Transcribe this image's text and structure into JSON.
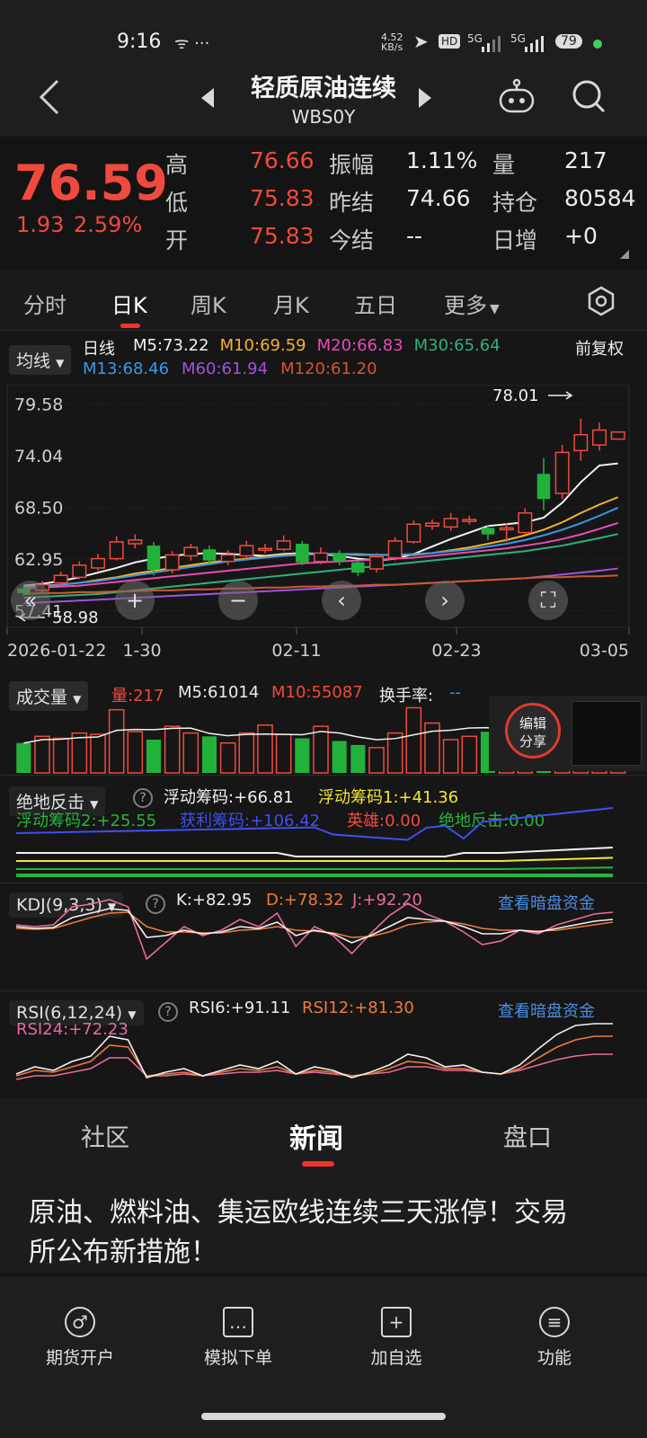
{
  "status": {
    "time": "9:16",
    "net_speed_top": "4.52",
    "net_speed_bottom": "KB/s",
    "hd": "HD",
    "sig1": "5G",
    "sig2": "5G",
    "battery": "79"
  },
  "header": {
    "title": "轻质原油连续",
    "code": "WBS0Y"
  },
  "quote": {
    "price": "76.59",
    "change": "1.93",
    "change_pct": "2.59%",
    "rows": [
      [
        {
          "label": "高",
          "value": "76.66"
        },
        {
          "label": "振幅",
          "value": "1.11%"
        },
        {
          "label": "量",
          "value": "217"
        }
      ],
      [
        {
          "label": "低",
          "value": "75.83"
        },
        {
          "label": "昨结",
          "value": "74.66"
        },
        {
          "label": "持仓",
          "value": "80584"
        }
      ],
      [
        {
          "label": "开",
          "value": "75.83"
        },
        {
          "label": "今结",
          "value": "--"
        },
        {
          "label": "日增",
          "value": "+0"
        }
      ]
    ]
  },
  "tabs": {
    "items": [
      "分时",
      "日K",
      "周K",
      "月K",
      "五日",
      "更多"
    ],
    "active": 1
  },
  "ma": {
    "dropdown": "均线",
    "type": "日线",
    "right_label": "前复权",
    "row1": [
      {
        "text": "M5:73.22",
        "color": "#f2f2f2"
      },
      {
        "text": "M10:69.59",
        "color": "#f6b22a"
      },
      {
        "text": "M20:66.83",
        "color": "#ea4bb2"
      },
      {
        "text": "M30:65.64",
        "color": "#2bb37a"
      }
    ],
    "row2": [
      {
        "text": "M13:68.46",
        "color": "#3a98e8"
      },
      {
        "text": "M60:61.94",
        "color": "#a052e0"
      },
      {
        "text": "M120:61.20",
        "color": "#d0582c"
      }
    ]
  },
  "kline": {
    "y_ticks": [
      "79.58",
      "74.04",
      "68.50",
      "62.95",
      "57.41"
    ],
    "x_ticks": [
      "2026-01-22",
      "1-30",
      "02-11",
      "02-23",
      "03-05"
    ],
    "max_label": "78.01",
    "min_label": "58.98",
    "candles": [
      {
        "o": 59.8,
        "c": 59.3,
        "h": 60.1,
        "l": 59.0
      },
      {
        "o": 59.6,
        "c": 60.2,
        "h": 60.6,
        "l": 59.4
      },
      {
        "o": 60.4,
        "c": 61.2,
        "h": 61.6,
        "l": 60.1
      },
      {
        "o": 61.0,
        "c": 62.3,
        "h": 62.7,
        "l": 60.8
      },
      {
        "o": 62.0,
        "c": 63.0,
        "h": 63.5,
        "l": 61.7
      },
      {
        "o": 63.0,
        "c": 64.8,
        "h": 65.4,
        "l": 62.8
      },
      {
        "o": 64.6,
        "c": 65.0,
        "h": 65.6,
        "l": 64.1
      },
      {
        "o": 64.4,
        "c": 61.8,
        "h": 64.8,
        "l": 61.2
      },
      {
        "o": 61.8,
        "c": 63.4,
        "h": 63.8,
        "l": 61.4
      },
      {
        "o": 63.3,
        "c": 64.2,
        "h": 64.6,
        "l": 62.8
      },
      {
        "o": 64.0,
        "c": 62.8,
        "h": 64.4,
        "l": 62.3
      },
      {
        "o": 62.7,
        "c": 63.4,
        "h": 63.9,
        "l": 62.3
      },
      {
        "o": 63.3,
        "c": 64.4,
        "h": 64.9,
        "l": 63.0
      },
      {
        "o": 64.0,
        "c": 64.1,
        "h": 64.6,
        "l": 63.6
      },
      {
        "o": 64.0,
        "c": 64.9,
        "h": 65.5,
        "l": 63.8
      },
      {
        "o": 64.6,
        "c": 62.6,
        "h": 64.9,
        "l": 62.3
      },
      {
        "o": 62.7,
        "c": 63.6,
        "h": 64.2,
        "l": 62.4
      },
      {
        "o": 63.6,
        "c": 62.7,
        "h": 63.9,
        "l": 62.3
      },
      {
        "o": 62.6,
        "c": 61.5,
        "h": 62.9,
        "l": 61.1
      },
      {
        "o": 61.9,
        "c": 63.2,
        "h": 63.6,
        "l": 61.5
      },
      {
        "o": 63.1,
        "c": 64.9,
        "h": 65.3,
        "l": 62.8
      },
      {
        "o": 64.8,
        "c": 66.7,
        "h": 67.1,
        "l": 64.6
      },
      {
        "o": 66.5,
        "c": 66.8,
        "h": 67.2,
        "l": 66.1
      },
      {
        "o": 66.4,
        "c": 67.3,
        "h": 67.9,
        "l": 66.0
      },
      {
        "o": 67.0,
        "c": 67.2,
        "h": 67.6,
        "l": 66.7
      },
      {
        "o": 66.3,
        "c": 65.6,
        "h": 66.6,
        "l": 65.0
      },
      {
        "o": 66.2,
        "c": 66.3,
        "h": 66.8,
        "l": 64.8
      },
      {
        "o": 65.8,
        "c": 67.9,
        "h": 68.4,
        "l": 65.6
      },
      {
        "o": 72.1,
        "c": 69.4,
        "h": 73.8,
        "l": 68.2
      },
      {
        "o": 70.0,
        "c": 74.4,
        "h": 75.2,
        "l": 69.4
      },
      {
        "o": 74.6,
        "c": 76.3,
        "h": 78.01,
        "l": 73.5
      },
      {
        "o": 75.2,
        "c": 76.8,
        "h": 77.6,
        "l": 74.6
      },
      {
        "o": 75.83,
        "c": 76.59,
        "h": 76.66,
        "l": 75.83
      }
    ],
    "ma_lines": [
      {
        "name": "M5",
        "color": "#f2f2f2",
        "values": [
          60.1,
          60.3,
          60.6,
          61.0,
          61.5,
          62.0,
          62.6,
          63.0,
          63.3,
          63.5,
          63.6,
          63.5,
          63.4,
          63.3,
          63.5,
          63.6,
          63.5,
          63.3,
          63.0,
          62.8,
          63.0,
          63.5,
          64.3,
          65.1,
          65.8,
          66.5,
          66.7,
          66.9,
          67.4,
          69.0,
          71.2,
          73.0,
          73.22
        ]
      },
      {
        "name": "M10",
        "color": "#f6b22a",
        "values": [
          60.0,
          60.1,
          60.2,
          60.4,
          60.7,
          61.0,
          61.4,
          61.7,
          62.0,
          62.3,
          62.6,
          62.8,
          63.0,
          63.2,
          63.4,
          63.5,
          63.5,
          63.5,
          63.4,
          63.4,
          63.4,
          63.4,
          63.6,
          63.9,
          64.2,
          64.6,
          65.0,
          65.5,
          66.1,
          66.9,
          67.9,
          68.8,
          69.59
        ]
      },
      {
        "name": "M20",
        "color": "#ea4bb2",
        "values": [
          59.8,
          59.9,
          60.0,
          60.1,
          60.3,
          60.5,
          60.7,
          60.9,
          61.1,
          61.3,
          61.5,
          61.7,
          61.9,
          62.1,
          62.3,
          62.5,
          62.6,
          62.7,
          62.8,
          62.9,
          63.0,
          63.1,
          63.3,
          63.5,
          63.7,
          63.9,
          64.1,
          64.4,
          64.7,
          65.1,
          65.6,
          66.2,
          66.83
        ]
      },
      {
        "name": "M30",
        "color": "#2bb37a",
        "values": [
          58.8,
          58.9,
          59.0,
          59.1,
          59.2,
          59.4,
          59.6,
          59.8,
          60.0,
          60.2,
          60.4,
          60.6,
          60.8,
          61.0,
          61.2,
          61.4,
          61.6,
          61.8,
          62.0,
          62.2,
          62.4,
          62.6,
          62.8,
          63.0,
          63.2,
          63.4,
          63.6,
          63.8,
          64.1,
          64.4,
          64.8,
          65.2,
          65.64
        ]
      },
      {
        "name": "M13",
        "color": "#3a98e8",
        "values": [
          59.9,
          60.0,
          60.2,
          60.4,
          60.6,
          60.9,
          61.2,
          61.5,
          61.8,
          62.1,
          62.4,
          62.7,
          62.9,
          63.1,
          63.3,
          63.4,
          63.5,
          63.5,
          63.5,
          63.4,
          63.4,
          63.5,
          63.6,
          63.8,
          64.0,
          64.3,
          64.6,
          65.0,
          65.5,
          66.1,
          66.8,
          67.6,
          68.46
        ]
      },
      {
        "name": "M60",
        "color": "#a052e0",
        "values": [
          58.2,
          58.3,
          58.4,
          58.5,
          58.6,
          58.7,
          58.8,
          58.9,
          59.0,
          59.1,
          59.2,
          59.3,
          59.4,
          59.5,
          59.6,
          59.7,
          59.8,
          59.9,
          60.0,
          60.1,
          60.2,
          60.3,
          60.4,
          60.5,
          60.6,
          60.7,
          60.8,
          60.9,
          61.1,
          61.3,
          61.5,
          61.7,
          61.94
        ]
      },
      {
        "name": "M120",
        "color": "#d0582c",
        "values": [
          59.2,
          59.3,
          59.3,
          59.4,
          59.4,
          59.5,
          59.5,
          59.6,
          59.6,
          59.7,
          59.7,
          59.8,
          59.8,
          59.9,
          59.9,
          60.0,
          60.0,
          60.1,
          60.1,
          60.2,
          60.2,
          60.3,
          60.4,
          60.5,
          60.6,
          60.7,
          60.8,
          60.9,
          61.0,
          61.0,
          61.1,
          61.1,
          61.2
        ]
      }
    ]
  },
  "volume": {
    "dropdown": "成交量",
    "vol": "量:217",
    "m5": "M5:61014",
    "m10": "M10:55087",
    "turnover": "换手率:",
    "turnover_val": "--",
    "badge_top": "编辑",
    "badge_bottom": "分享",
    "bars": [
      0.45,
      0.55,
      0.52,
      0.6,
      0.58,
      0.95,
      0.62,
      0.5,
      0.7,
      0.6,
      0.55,
      0.45,
      0.6,
      0.72,
      0.58,
      0.52,
      0.7,
      0.48,
      0.42,
      0.38,
      0.6,
      0.98,
      0.75,
      0.5,
      0.55,
      0.62,
      0.5,
      0.58,
      0.4,
      0.35,
      0.3,
      0.28,
      0.05
    ]
  },
  "chip": {
    "dropdown": "绝地反击",
    "items": [
      {
        "text": "浮动筹码:+66.81",
        "color": "#f2f2f2"
      },
      {
        "text": "浮动筹码1:+41.36",
        "color": "#f2e830"
      },
      {
        "text": "浮动筹码2:+25.55",
        "color": "#27b43c"
      },
      {
        "text": "获利筹码:+106.42",
        "color": "#3f4ff0"
      },
      {
        "text": "英雄:0.00",
        "color": "#f04a3e"
      },
      {
        "text": "绝地反击:0.00",
        "color": "#27b43c"
      }
    ]
  },
  "kdj": {
    "dropdown": "KDJ(9,3,3)",
    "k": "K:+82.95",
    "d": "D:+78.32",
    "j": "J:+92.20",
    "link": "查看暗盘资金"
  },
  "rsi": {
    "dropdown": "RSI(6,12,24)",
    "rsi6": "RSI6:+91.11",
    "rsi12": "RSI12:+81.30",
    "rsi24": "RSI24:+72.23",
    "link": "查看暗盘资金"
  },
  "news_tabs": {
    "items": [
      "社区",
      "新闻",
      "盘口"
    ],
    "active": 1
  },
  "news": {
    "headline": "原油、燃料油、集运欧线连续三天涨停！交易所公布新措施！"
  },
  "bottom_nav": [
    {
      "label": "期货开户",
      "icon": "♂"
    },
    {
      "label": "模拟下单",
      "icon": "…"
    },
    {
      "label": "加自选",
      "icon": "+"
    },
    {
      "label": "功能",
      "icon": "≡"
    }
  ]
}
